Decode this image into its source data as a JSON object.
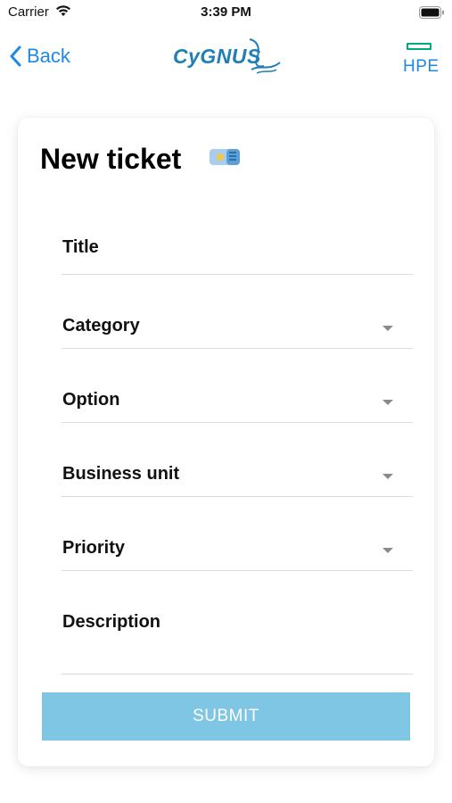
{
  "status_bar": {
    "carrier": "Carrier",
    "time": "3:39 PM"
  },
  "nav": {
    "back_label": "Back",
    "logo_text": "CyGNUS",
    "partner_label": "HPE"
  },
  "form": {
    "title": "New ticket",
    "fields": [
      {
        "label": "Title",
        "type": "text"
      },
      {
        "label": "Category",
        "type": "dropdown"
      },
      {
        "label": "Option",
        "type": "dropdown"
      },
      {
        "label": "Business unit",
        "type": "dropdown"
      },
      {
        "label": "Priority",
        "type": "dropdown"
      },
      {
        "label": "Description",
        "type": "textarea"
      }
    ],
    "submit_label": "SUBMIT"
  },
  "colors": {
    "accent": "#1e88e5",
    "submit_bg": "#7fc6e4",
    "hpe_green": "#01a982",
    "logo_blue": "#1f7fb6"
  },
  "icons": [
    "wifi-icon",
    "battery-icon",
    "chevron-left-icon",
    "ticket-icon",
    "chevron-down-icon"
  ]
}
